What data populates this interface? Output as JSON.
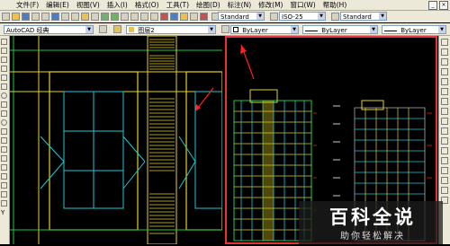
{
  "menu": [
    "文件(F)",
    "编辑(E)",
    "视图(V)",
    "插入(I)",
    "格式(O)",
    "工具(T)",
    "绘图(D)",
    "标注(N)",
    "修改(M)",
    "窗口(W)",
    "帮助(H)"
  ],
  "toolbar": {
    "text_style": "Standard",
    "dim_style": "ISO-25",
    "table_style": "Standard",
    "workspace": "AutoCAD 经典",
    "layer": "图层2",
    "color": "ByLayer",
    "linetype": "ByLayer",
    "lineweight": "ByLayer"
  },
  "watermark": {
    "title": "百科全说",
    "subtitle": "助你轻松解决"
  },
  "colors": {
    "highlight_border": "#e8313a",
    "cad_yellow": "#e6d21a",
    "cad_cyan": "#1ec8d8",
    "cad_green": "#22c640",
    "cad_red": "#ff2020"
  }
}
